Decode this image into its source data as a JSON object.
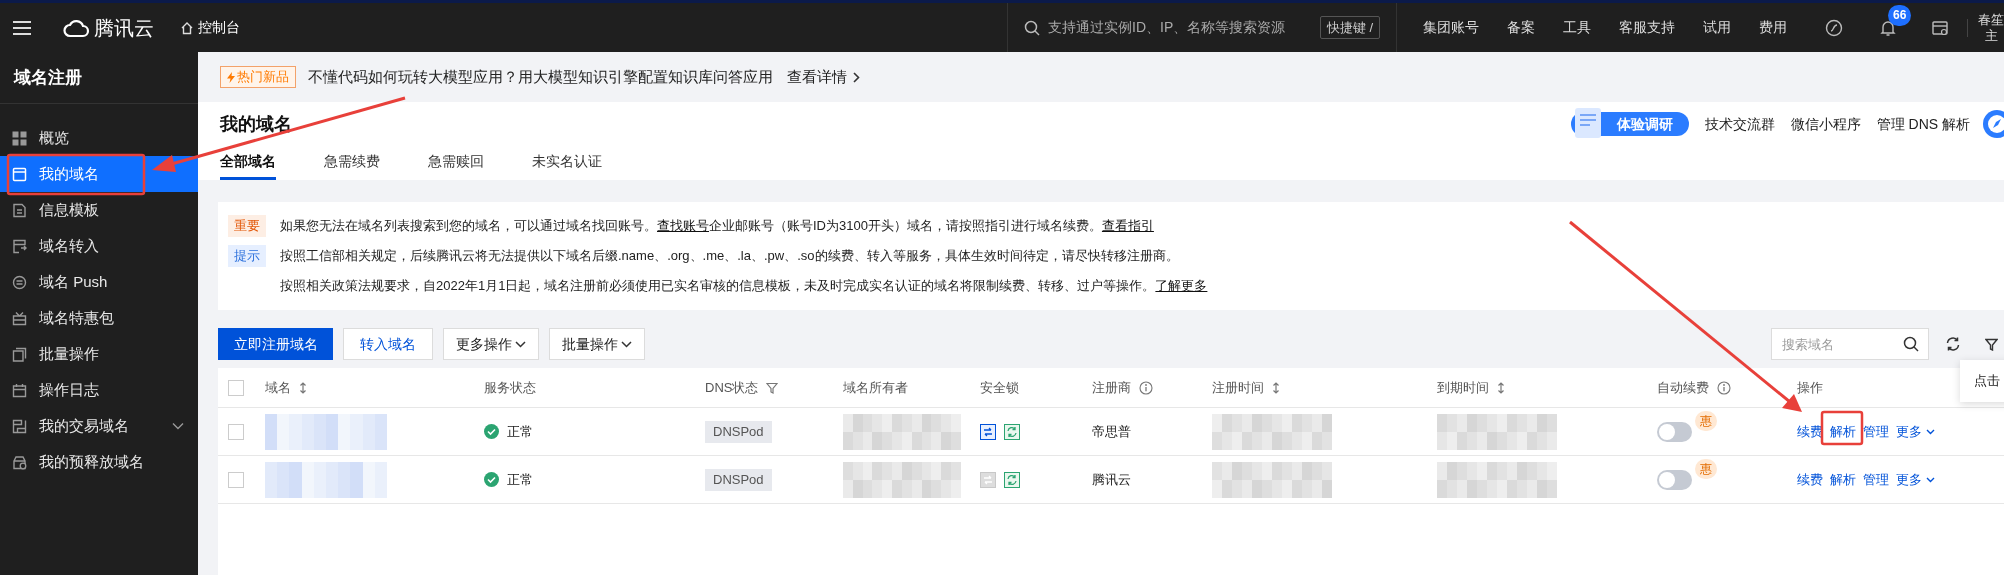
{
  "topbar": {
    "brand": "腾讯云",
    "console": "控制台",
    "search": {
      "placeholder": "支持通过实例ID、IP、名称等搜索资源",
      "shortcut": "快捷键 /"
    },
    "nav": [
      "集团账号",
      "备案",
      "工具",
      "客服支持",
      "试用",
      "费用"
    ],
    "notifications": "66",
    "account": [
      "春笙",
      "主"
    ]
  },
  "sidebar": {
    "title": "域名注册",
    "items": [
      {
        "label": "概览",
        "selected": false,
        "kind": "link"
      },
      {
        "label": "我的域名",
        "selected": true,
        "kind": "link"
      },
      {
        "label": "信息模板",
        "selected": false,
        "kind": "link"
      },
      {
        "label": "域名转入",
        "selected": false,
        "kind": "link"
      },
      {
        "label": "域名 Push",
        "selected": false,
        "kind": "link"
      },
      {
        "label": "域名特惠包",
        "selected": false,
        "kind": "link"
      },
      {
        "label": "批量操作",
        "selected": false,
        "kind": "link"
      },
      {
        "label": "操作日志",
        "selected": false,
        "kind": "link"
      },
      {
        "label": "我的交易域名",
        "selected": false,
        "kind": "group"
      },
      {
        "label": "我的预释放域名",
        "selected": false,
        "kind": "link"
      }
    ]
  },
  "banner": {
    "tag": "热门新品",
    "text": "不懂代码如何玩转大模型应用？用大模型知识引擎配置知识库问答应用",
    "link": "查看详情"
  },
  "page": {
    "title": "我的域名",
    "tabs": [
      {
        "label": "全部域名",
        "selected": true
      },
      {
        "label": "急需续费",
        "selected": false
      },
      {
        "label": "急需赎回",
        "selected": false
      },
      {
        "label": "未实名认证",
        "selected": false
      }
    ],
    "survey": "体验调研",
    "links": [
      "技术交流群",
      "微信小程序",
      "管理 DNS 解析"
    ]
  },
  "notices": [
    {
      "kind": "important",
      "tag": "重要",
      "parts": [
        {
          "text": "如果您无法在域名列表搜索到您的域名，可以通过域名找回账号。"
        },
        {
          "link": "查找账号"
        },
        {
          "text": " 企业邮账号（账号ID为3100开头）域名，请按照指引进行域名续费。"
        },
        {
          "link": "查看指引"
        }
      ]
    },
    {
      "kind": "hint",
      "tag": "提示",
      "parts": [
        {
          "text": "按照工信部相关规定，后续腾讯云将无法提供以下域名后缀.name、.org、.me、.la、.pw、.so的续费、转入等服务，具体生效时间待定，请尽快转移注册商。"
        }
      ]
    },
    {
      "kind": "plain",
      "parts": [
        {
          "text": "按照相关政策法规要求，自2022年1月1日起，域名注册前必须使用已实名审核的信息模板，未及时完成实名认证的域名将限制续费、转移、过户等操作。"
        },
        {
          "link": "了解更多"
        }
      ]
    }
  ],
  "toolbar": {
    "buttons": [
      {
        "label": "立即注册域名",
        "kind": "primary"
      },
      {
        "label": "转入域名",
        "kind": "secondary"
      },
      {
        "label": "更多操作",
        "kind": "dropdown"
      },
      {
        "label": "批量操作",
        "kind": "dropdown"
      }
    ],
    "search": {
      "placeholder": "搜索域名"
    },
    "popover": "点击"
  },
  "table": {
    "all_selected": false,
    "columns": [
      {
        "label": "域名",
        "kind": "sortable"
      },
      {
        "label": "服务状态",
        "kind": "plain"
      },
      {
        "label": "DNS状态",
        "kind": "filterable"
      },
      {
        "label": "域名所有者",
        "kind": "plain"
      },
      {
        "label": "安全锁",
        "kind": "plain"
      },
      {
        "label": "注册商",
        "kind": "help"
      },
      {
        "label": "注册时间",
        "kind": "sortable"
      },
      {
        "label": "到期时间",
        "kind": "sortable"
      },
      {
        "label": "自动续费",
        "kind": "help"
      },
      {
        "label": "操作",
        "kind": "plain"
      }
    ],
    "rows": [
      {
        "selected": false,
        "status": "正常",
        "dns": "DNSPod",
        "transfer_lock": true,
        "registrar": "帝思普",
        "auto_renew": false,
        "promo": "惠",
        "actions": [
          "续费",
          "解析",
          "管理",
          "更多"
        ]
      },
      {
        "selected": false,
        "status": "正常",
        "dns": "DNSPod",
        "transfer_lock": false,
        "registrar": "腾讯云",
        "auto_renew": false,
        "promo": "惠",
        "actions": [
          "续费",
          "解析",
          "管理",
          "更多"
        ]
      }
    ]
  }
}
